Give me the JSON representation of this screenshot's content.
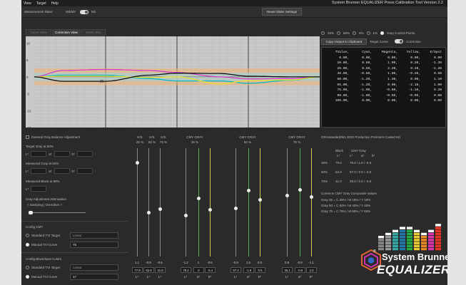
{
  "menu": [
    "View",
    "Target",
    "Help"
  ],
  "app_title": "System Brunner EQUALIZER Press Calibration Tool Version 2.2",
  "toolbar": {
    "measurement_base": "Measurement Base:",
    "m0m2": "M0/M2",
    "m1": "M1",
    "reset": "Reset Slider Settings"
  },
  "tabs": [
    "Curve View",
    "Correction View",
    "Matrix Box"
  ],
  "chart_modes": [
    "25%",
    "50%",
    "0%",
    "1%",
    "Gray Control Points"
  ],
  "copy_button": "Copy Output to Clipboard",
  "target_curve": "Target Curve",
  "correction": "Correction",
  "table": {
    "headers": [
      "TValue,",
      "Cyan,",
      "Magenta,",
      "Yellow,",
      "K/Spot"
    ],
    "rows": [
      [
        "0.00,",
        "0.00,",
        "0.00,",
        "0.00,",
        "0.00"
      ],
      [
        "10.00,",
        "0.50,",
        "1.90,",
        "0.20,",
        "-1.30"
      ],
      [
        "25.00,",
        "0.50,",
        "2.20,",
        "0.20,",
        "-1.30"
      ],
      [
        "40.00,",
        "-0.50,",
        "1.90,",
        "-0.20,",
        "0.50"
      ],
      [
        "50.00,",
        "-1.20,",
        "1.30,",
        "0.00,",
        "1.10"
      ],
      [
        "65.00,",
        "-1.20,",
        "0.00,",
        "-2.10,",
        "1.00"
      ],
      [
        "75.00,",
        "-1.90,",
        "-0.60,",
        "-1.10,",
        "0.20"
      ],
      [
        "90.00,",
        "-1.00,",
        "-0.50,",
        "-0.90,",
        "0.00"
      ],
      [
        "100.00,",
        "0.00,",
        "0.00,",
        "0.00,",
        "0.00"
      ]
    ]
  },
  "chart_data": {
    "type": "line",
    "y_ticks": [
      "10",
      "5",
      "0",
      "-5",
      "-10",
      "-15"
    ],
    "ylim": [
      -15,
      12
    ],
    "x": [
      0,
      10,
      25,
      40,
      50,
      65,
      75,
      90,
      100
    ],
    "inline_label": "25",
    "series": [
      {
        "color": "#00b8c8",
        "values": [
          0,
          0.5,
          0.5,
          -0.5,
          -1.2,
          -1.2,
          -1.9,
          -1.0,
          0
        ]
      },
      {
        "color": "#d040c8",
        "values": [
          0,
          1.9,
          2.2,
          1.9,
          1.3,
          0,
          -0.6,
          -0.5,
          0
        ]
      },
      {
        "color": "#e8e030",
        "values": [
          0,
          0.2,
          0.2,
          -0.2,
          0,
          -2.1,
          -1.1,
          -0.9,
          0
        ]
      },
      {
        "color": "#101010",
        "values": [
          0,
          -1.3,
          -1.3,
          0.5,
          1.1,
          1.0,
          0.2,
          0,
          0
        ]
      }
    ]
  },
  "left": {
    "gray_balance": "General Gray Balance Adjustment",
    "target_gray": "Target Gray at 50%",
    "measured_gray": "Measured Gray at 50%",
    "measured_black": "Measured Black at 90%",
    "L": "L*",
    "a": "a*",
    "b": "b*",
    "attenuation": "Gray Adjustment Attenuation",
    "damping": "< Damping | Overdrive >",
    "config_cmy": "Config CMY",
    "std_tvi": "Standard TVI Target",
    "manual_tvi": "Manual TVI Curve",
    "std_value": "Linear",
    "manual_value": "76",
    "config_k": "Config Black/Spot Colors",
    "std_value2": "Linear",
    "manual_value2": "17"
  },
  "sliders": {
    "groups": [
      {
        "label": "K/S",
        "sub": "25 %"
      },
      {
        "label": "K/S",
        "sub": "50 %"
      },
      {
        "label": "K/S",
        "sub": "75 %"
      },
      {
        "label": "CMY GRAY",
        "sub": "25 %"
      },
      {
        "label": "CMY GRAY",
        "sub": "50 %"
      },
      {
        "label": "CMY GRAY",
        "sub": "75 %"
      }
    ],
    "values": [
      "1.1",
      "-0.9",
      "-0.6",
      "-1.2",
      "1",
      "-0.6",
      "-0.9",
      "1.5",
      "0.5",
      "0.9",
      "-0.9",
      "-1.1"
    ],
    "boxes": [
      "77.9",
      "62.9",
      "41.8",
      "79.2",
      "0",
      "-5.4",
      "57.3",
      "-1.9",
      "0.5",
      "36.1",
      "-0.9",
      "2.0"
    ],
    "axis": [
      "L*",
      "L*",
      "L*",
      "L*",
      "a*",
      "b*",
      "L*",
      "a*",
      "b*",
      "L*",
      "a*",
      "b*"
    ]
  },
  "right": {
    "profile": "GRAstandard/M1 2022 Production Premium Coated M1",
    "h_black": "Black",
    "h_cmy": "CMY Gray",
    "sub_L": "L*",
    "sub_L2": "L*",
    "sub_a": "a*",
    "sub_b": "b*",
    "rows": [
      {
        "pct": "25%",
        "k": "79.0",
        "cmy": "79.0 / 1.0 / -6.0"
      },
      {
        "pct": "50%",
        "k": "62.0",
        "cmy": "57.0 / 0.0 / -5.0"
      },
      {
        "pct": "75%",
        "k": "41.0",
        "cmy": "39.0 / 0.0 / -5.0"
      }
    ],
    "composite_title": "Common CMY Gray Composite Values",
    "composites": [
      "Gray 25 = C 25% / M 18% / Y 18%",
      "Gray 50 = C 50% / M 40% / Y 40%",
      "Gray 75 = C 75% / M 65% / Y 65%"
    ]
  },
  "logo": {
    "line1": "System Brunner",
    "line2": "EQUALIZER",
    "reg": "®"
  }
}
